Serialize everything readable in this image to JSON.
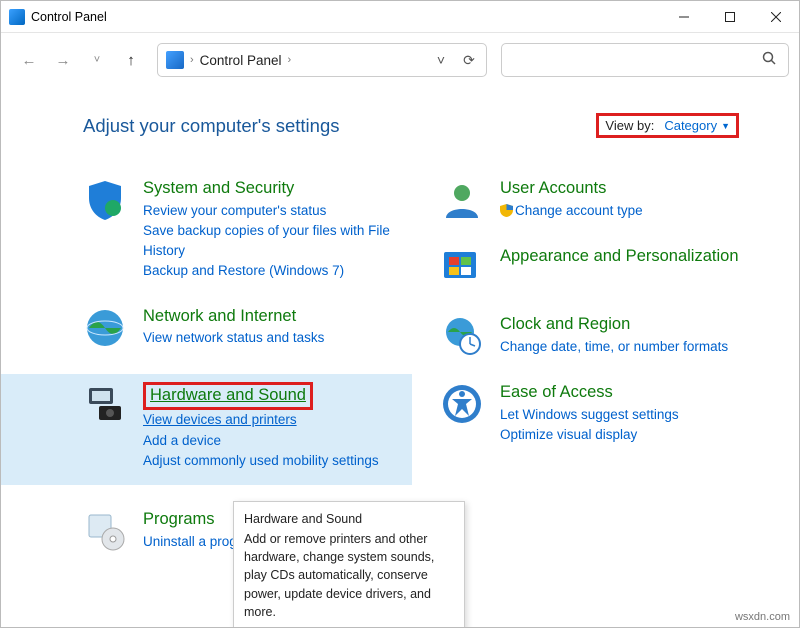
{
  "titlebar": {
    "title": "Control Panel"
  },
  "address": {
    "text": "Control Panel"
  },
  "heading": "Adjust your computer's settings",
  "viewby": {
    "label": "View by:",
    "value": "Category"
  },
  "left": {
    "system": {
      "title": "System and Security",
      "l1": "Review your computer's status",
      "l2": "Save backup copies of your files with File History",
      "l3": "Backup and Restore (Windows 7)"
    },
    "network": {
      "title": "Network and Internet",
      "l1": "View network status and tasks"
    },
    "hardware": {
      "title": "Hardware and Sound",
      "l1": "View devices and printers",
      "l2": "Add a device",
      "l3": "Adjust commonly used mobility settings"
    },
    "programs": {
      "title": "Programs",
      "l1": "Uninstall a program"
    }
  },
  "right": {
    "users": {
      "title": "User Accounts",
      "l1": "Change account type"
    },
    "appearance": {
      "title": "Appearance and Personalization"
    },
    "clock": {
      "title": "Clock and Region",
      "l1": "Change date, time, or number formats"
    },
    "ease": {
      "title": "Ease of Access",
      "l1": "Let Windows suggest settings",
      "l2": "Optimize visual display"
    }
  },
  "tooltip": {
    "title": "Hardware and Sound",
    "body": "Add or remove printers and other hardware, change system sounds, play CDs automatically, conserve power, update device drivers, and more."
  },
  "watermark": "wsxdn.com"
}
